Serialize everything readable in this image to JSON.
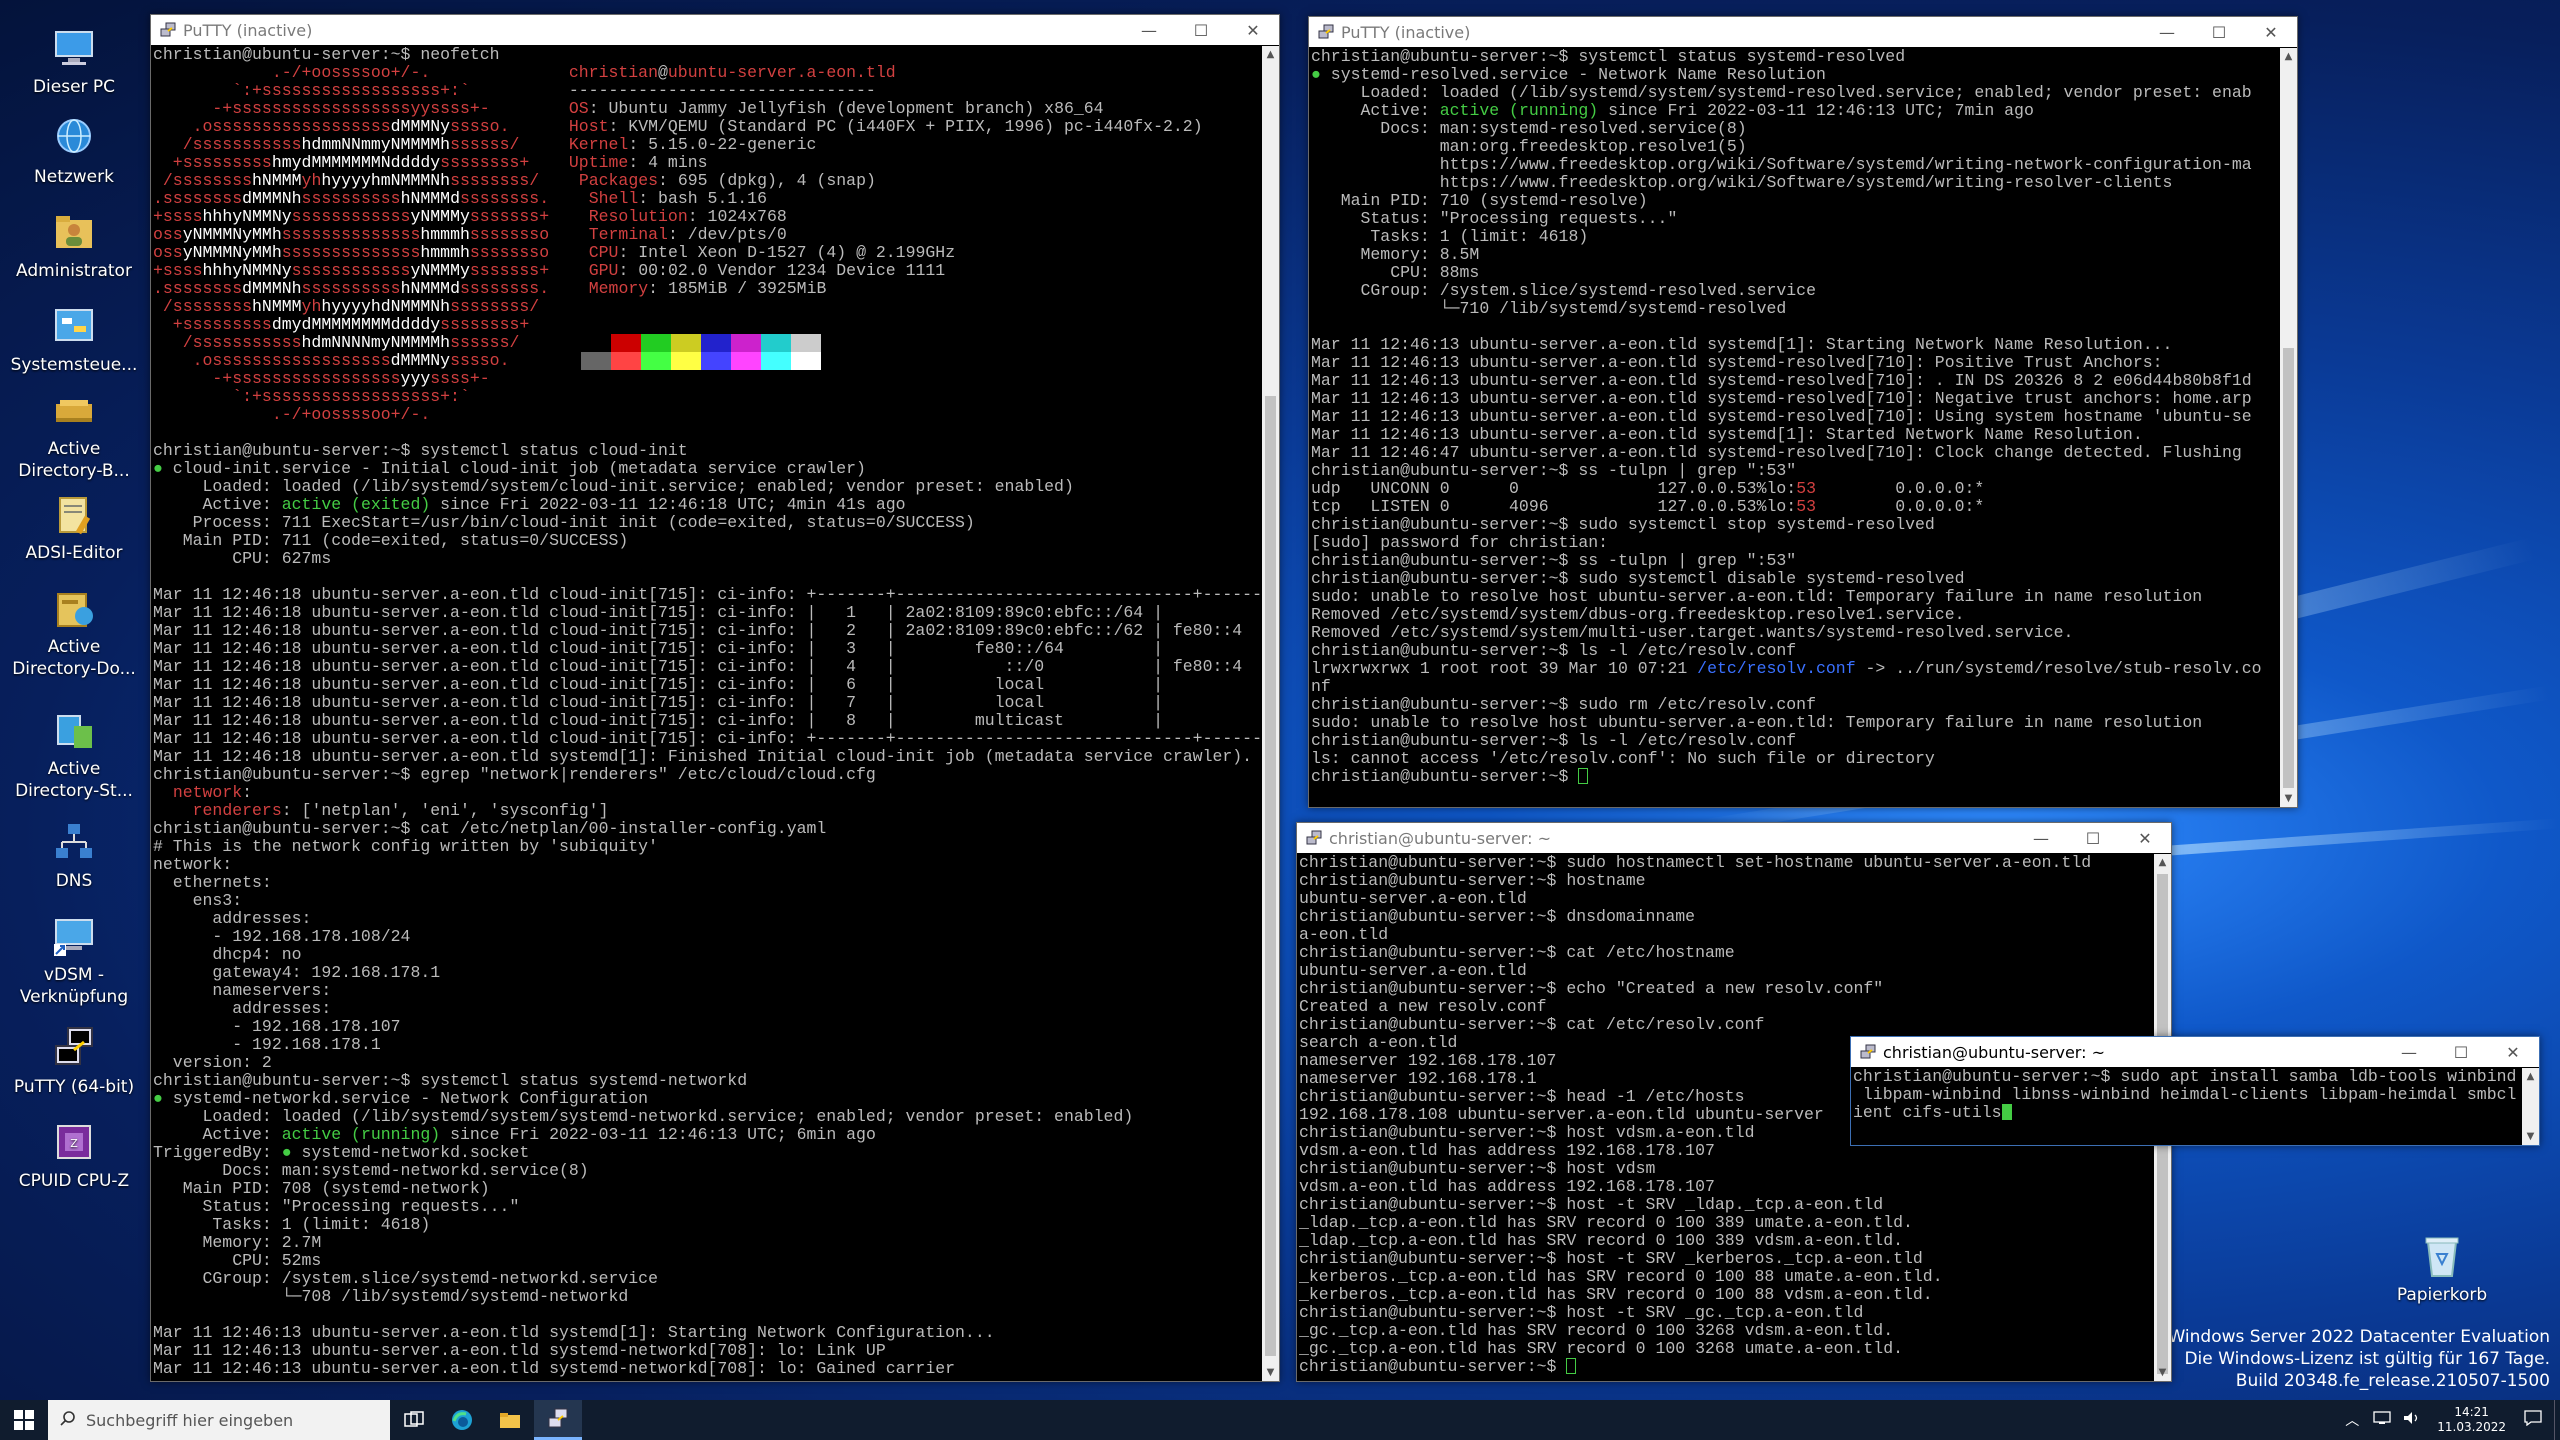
{
  "desktop": {
    "icons": [
      {
        "label": "Dieser PC",
        "icon": "computer-icon"
      },
      {
        "label": "Netzwerk",
        "icon": "network-globe-icon"
      },
      {
        "label": "Administrator",
        "icon": "user-folder-icon"
      },
      {
        "label": "Systemsteue...",
        "icon": "control-panel-icon"
      },
      {
        "label": "Active Directory-B...",
        "icon": "ad-users-icon"
      },
      {
        "label": "ADSI-Editor",
        "icon": "adsi-editor-icon"
      },
      {
        "label": "Active Directory-Do...",
        "icon": "ad-domains-icon"
      },
      {
        "label": "Active Directory-St...",
        "icon": "ad-sites-icon"
      },
      {
        "label": "DNS",
        "icon": "dns-icon"
      },
      {
        "label": "vDSM - Verknüpfung",
        "icon": "vdsm-shortcut-icon"
      },
      {
        "label": "PuTTY (64-bit)",
        "icon": "putty-icon"
      },
      {
        "label": "CPUID CPU-Z",
        "icon": "cpuz-icon"
      }
    ],
    "recycle_bin": "Papierkorb",
    "watermark": {
      "line1": "Windows Server 2022 Datacenter Evaluation",
      "line2": "Die Windows-Lizenz ist gültig für 167 Tage.",
      "line3": "Build 20348.fe_release.210507-1500"
    }
  },
  "windows": {
    "w1": {
      "title": "PuTTY (inactive)"
    },
    "w2": {
      "title": "PuTTY (inactive)"
    },
    "w3": {
      "title": "christian@ubuntu-server: ~"
    },
    "w4": {
      "title": "christian@ubuntu-server: ~"
    }
  },
  "terminal_colors": {
    "green": "#44cc44",
    "red": "#d24040",
    "blue": "#3a70ff",
    "gray": "#bbbbbb"
  },
  "taskbar": {
    "search_placeholder": "Suchbegriff hier eingeben",
    "time": "14:21",
    "date": "11.03.2022"
  }
}
